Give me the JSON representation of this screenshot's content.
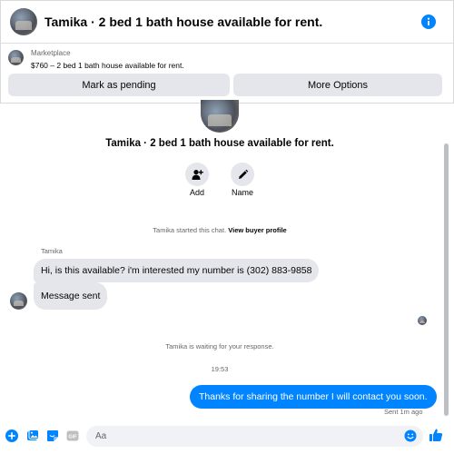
{
  "header": {
    "title": "Tamika · 2 bed 1 bath house available for rent.",
    "icon": "info-icon"
  },
  "marketplace": {
    "label": "Marketplace",
    "price_line": "$760 – 2 bed 1 bath house available for rent.",
    "mark_pending": "Mark as pending",
    "more_options": "More Options"
  },
  "profile": {
    "title": "Tamika · 2 bed 1 bath house available for rent.",
    "actions": [
      {
        "label": "Add",
        "icon": "add-person-icon"
      },
      {
        "label": "Name",
        "icon": "pencil-icon"
      }
    ]
  },
  "messages": {
    "started_prefix": "Tamika started this chat.",
    "view_buyer_profile": "View buyer profile",
    "sender": "Tamika",
    "incoming": [
      "Hi, is this available? i'm interested my number is (302) 883-9858",
      "Message sent"
    ],
    "waiting": "Tamika is waiting for your response.",
    "timestamp": "19:53",
    "outgoing": "Thanks for sharing the number I will contact you soon.",
    "sent_status": "Sent 1m ago"
  },
  "composer": {
    "placeholder": "Aa",
    "icons": [
      "plus-icon",
      "image-icon",
      "sticker-icon",
      "gif-icon",
      "emoji-icon",
      "thumbs-up-icon"
    ]
  },
  "colors": {
    "accent": "#0084ff",
    "bubble_gray": "#e4e6eb",
    "secondary_text": "#65676b"
  }
}
